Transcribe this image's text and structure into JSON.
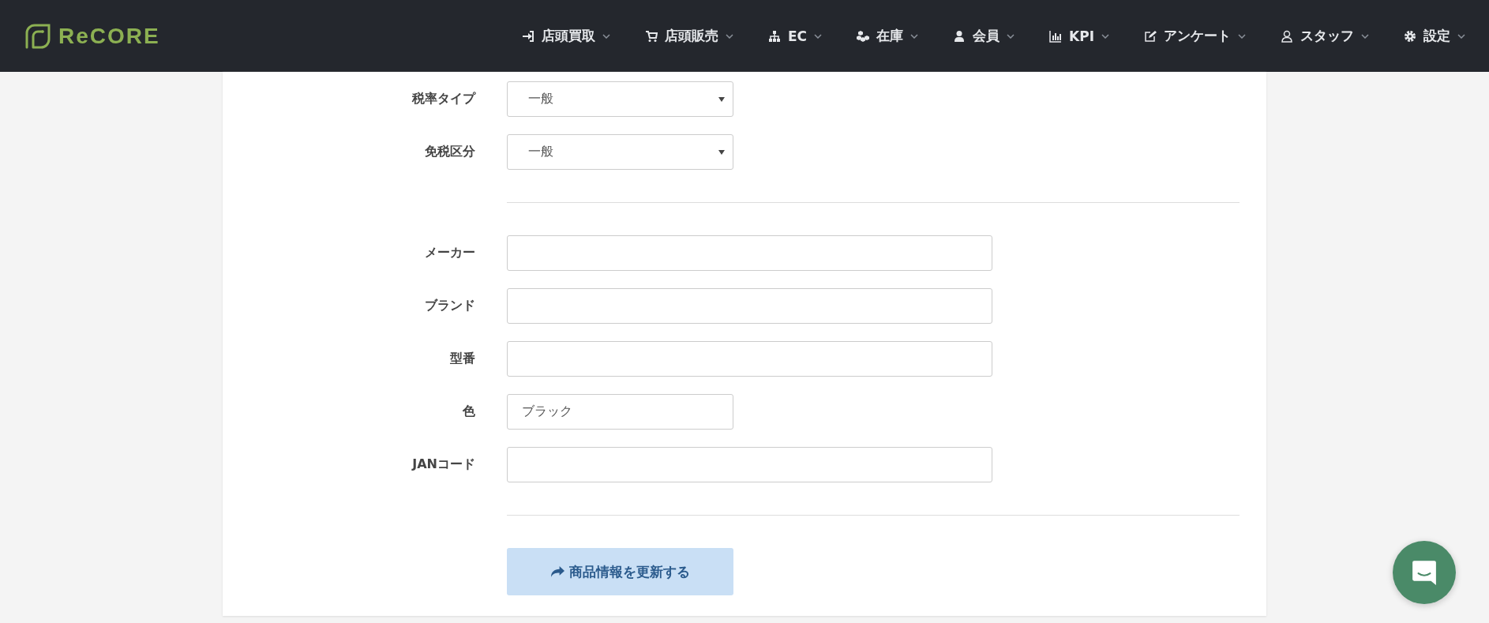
{
  "header": {
    "logo": "ReCORE",
    "nav": [
      {
        "label": "店頭買取"
      },
      {
        "label": "店頭販売"
      },
      {
        "label": "EC"
      },
      {
        "label": "在庫"
      },
      {
        "label": "会員"
      },
      {
        "label": "KPI"
      },
      {
        "label": "アンケート"
      },
      {
        "label": "スタッフ"
      },
      {
        "label": "設定"
      }
    ]
  },
  "form": {
    "sections": [
      {
        "fields": [
          {
            "kind": "select",
            "label": "税率タイプ",
            "value": "一般"
          },
          {
            "kind": "select",
            "label": "免税区分",
            "value": "一般"
          }
        ]
      },
      {
        "fields": [
          {
            "kind": "text",
            "label": "メーカー"
          },
          {
            "kind": "text",
            "label": "ブランド"
          },
          {
            "kind": "text",
            "label": "型番"
          },
          {
            "kind": "short",
            "label": "色",
            "value": "ブラック"
          },
          {
            "kind": "text",
            "label": "JANコード"
          }
        ]
      }
    ],
    "submit": "商品情報を更新する"
  }
}
